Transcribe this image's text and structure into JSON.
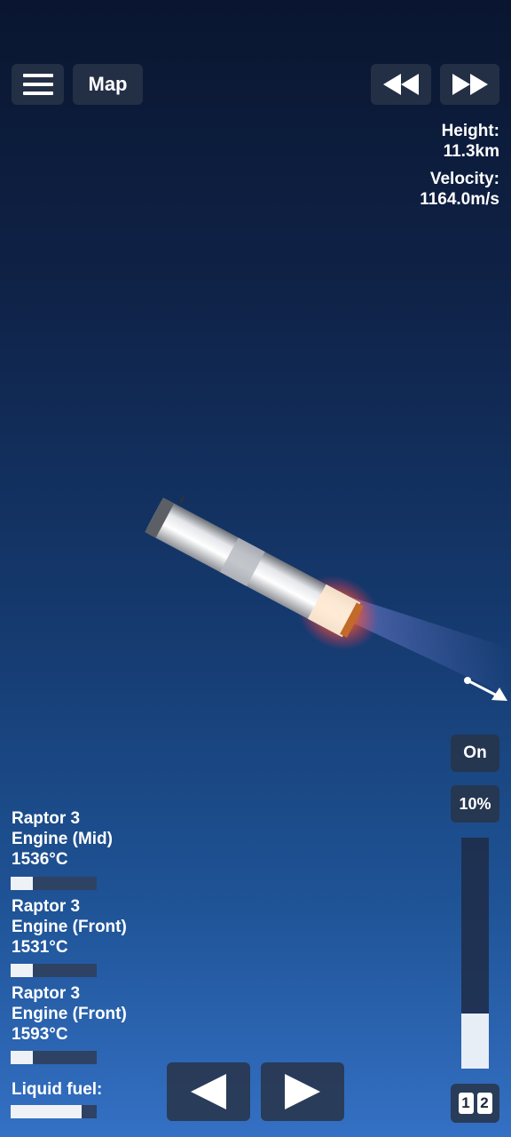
{
  "toolbar": {
    "menu_icon": "hamburger-menu-icon",
    "map_label": "Map",
    "rewind_icon": "rewind-icon",
    "fast_forward_icon": "fast-forward-icon"
  },
  "telemetry": {
    "height_label": "Height:",
    "height_value": "11.3km",
    "velocity_label": "Velocity:",
    "velocity_value": "1164.0m/s"
  },
  "controls": {
    "engine_toggle": "On",
    "throttle_label": "10%",
    "throttle_level": 0.24,
    "stage_left": "1",
    "stage_right": "2"
  },
  "engines": [
    {
      "name_line1": "Raptor 3",
      "name_line2": "Engine (Mid)",
      "temp": "1536°C",
      "heat_level": 0.26
    },
    {
      "name_line1": "Raptor 3",
      "name_line2": "Engine (Front)",
      "temp": "1531°C",
      "heat_level": 0.26
    },
    {
      "name_line1": "Raptor 3",
      "name_line2": "Engine (Front)",
      "temp": "1593°C",
      "heat_level": 0.26
    }
  ],
  "fuel": {
    "label": "Liquid fuel:",
    "level": 0.82
  },
  "rotate": {
    "left_icon": "rotate-left-arrow-icon",
    "right_icon": "rotate-right-arrow-icon"
  },
  "colors": {
    "sky_top": "#0a1630",
    "sky_bottom": "#3470c4",
    "button_bg": "#283448",
    "bar_bg": "#2e4264",
    "fill": "#eef2f7"
  }
}
